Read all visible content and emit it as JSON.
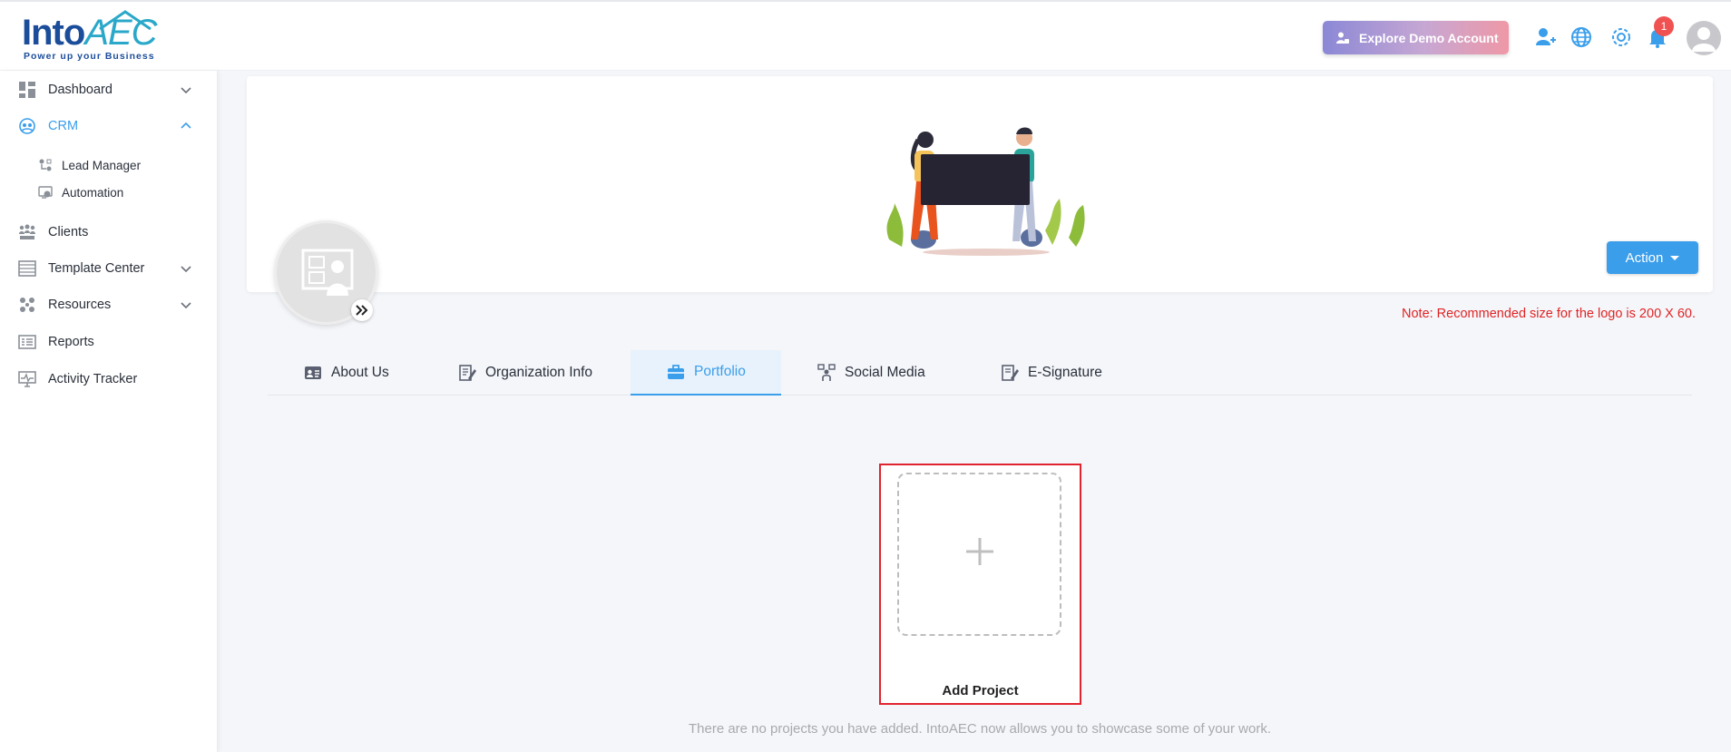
{
  "header": {
    "logo_main": "Into",
    "logo_accent": "AEC",
    "logo_tagline": "Power up your Business",
    "demo_button": "Explore Demo Account",
    "notification_count": "1",
    "icons": [
      "add-user-icon",
      "globe-icon",
      "gear-icon",
      "bell-icon",
      "avatar"
    ]
  },
  "sidebar": {
    "items": [
      {
        "label": "Dashboard",
        "icon": "dashboard-icon",
        "chevron": "down"
      },
      {
        "label": "CRM",
        "icon": "crm-icon",
        "chevron": "up",
        "active": true
      },
      {
        "label": "Clients",
        "icon": "clients-icon"
      },
      {
        "label": "Template Center",
        "icon": "template-icon",
        "chevron": "down"
      },
      {
        "label": "Resources",
        "icon": "resources-icon",
        "chevron": "down"
      },
      {
        "label": "Reports",
        "icon": "reports-icon"
      },
      {
        "label": "Activity Tracker",
        "icon": "activity-icon"
      }
    ],
    "crm_children": [
      {
        "label": "Lead Manager",
        "icon": "lead-manager-icon"
      },
      {
        "label": "Automation",
        "icon": "automation-icon"
      }
    ]
  },
  "banner": {
    "action_label": "Action",
    "note": "Note: Recommended size for the logo is 200 X 60."
  },
  "tabs": [
    {
      "label": "About Us",
      "icon": "id-card-icon"
    },
    {
      "label": "Organization Info",
      "icon": "edit-doc-icon"
    },
    {
      "label": "Portfolio",
      "icon": "briefcase-icon",
      "active": true
    },
    {
      "label": "Social Media",
      "icon": "social-icon"
    },
    {
      "label": "E-Signature",
      "icon": "signature-icon"
    }
  ],
  "portfolio": {
    "add_label": "Add Project",
    "empty_message": "There are no projects you have added. IntoAEC now allows you to showcase some of your work."
  },
  "colors": {
    "accent": "#3a9eeb",
    "note_red": "#e02424",
    "highlight_border": "#e0232e",
    "badge": "#f05252"
  }
}
